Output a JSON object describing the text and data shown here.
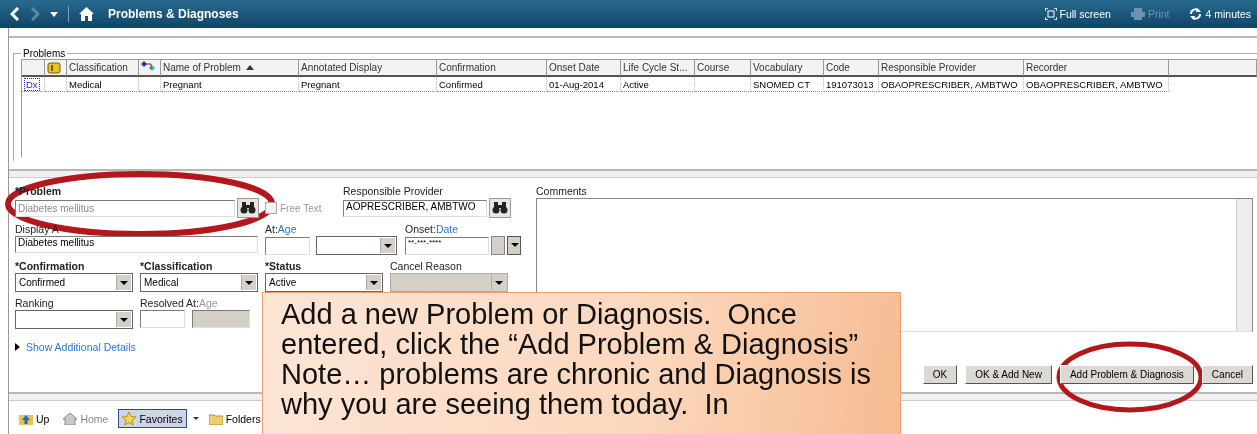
{
  "header": {
    "title": "Problems & Diagnoses",
    "actions": [
      {
        "label": "Full screen",
        "kind": "fullscreen",
        "disabled": false
      },
      {
        "label": "Print",
        "kind": "print",
        "disabled": true
      },
      {
        "label": "4 minutes",
        "kind": "refresh",
        "disabled": false
      }
    ]
  },
  "problems": {
    "legend": "Problems",
    "columns": [
      {
        "kind": "marker"
      },
      {
        "kind": "icon"
      },
      {
        "kind": "text",
        "label": "Classification",
        "sorted": false
      },
      {
        "kind": "icon"
      },
      {
        "kind": "text",
        "label": "Name of Problem",
        "sorted": true
      },
      {
        "kind": "text",
        "label": "Annotated Display",
        "sorted": false
      },
      {
        "kind": "text",
        "label": "Confirmation",
        "sorted": false
      },
      {
        "kind": "text",
        "label": "Onset Date",
        "sorted": false
      },
      {
        "kind": "text",
        "label": "Life Cycle St...",
        "sorted": false
      },
      {
        "kind": "text",
        "label": "Course",
        "sorted": false
      },
      {
        "kind": "text",
        "label": "Vocabulary",
        "sorted": false
      },
      {
        "kind": "text",
        "label": "Code",
        "sorted": false
      },
      {
        "kind": "text",
        "label": "Responsible Provider",
        "sorted": false
      },
      {
        "kind": "text",
        "label": "Recorder",
        "sorted": false
      }
    ],
    "rows": [
      {
        "cells": [
          "Dx",
          "",
          "Medical",
          "",
          "Pregnant",
          "Pregnant",
          "Confirmed",
          "01-Aug-2014",
          "Active",
          "",
          "SNOMED CT",
          "191073013",
          "OBAOPRESCRIBER, AMBTWO",
          "OBAOPRESCRIBER, AMBTWO"
        ]
      }
    ]
  },
  "form": {
    "problem": {
      "label": "*Problem",
      "placeholder": "Diabetes mellitus"
    },
    "free_text": {
      "label": "Free Text",
      "checked": false,
      "disabled": true
    },
    "responsible_provider": {
      "label": "Responsible Provider",
      "value": "AOPRESCRIBER, AMBTWO"
    },
    "display_as": {
      "label": "Display A",
      "value": "Diabetes mellitus"
    },
    "at": {
      "label": "At:",
      "link": "Age"
    },
    "onset": {
      "label": "Onset:",
      "link": "Date",
      "value": "**-***-****"
    },
    "confirmation": {
      "label": "*Confirmation",
      "value": "Confirmed"
    },
    "classification": {
      "label": "*Classification",
      "value": "Medical"
    },
    "status": {
      "label": "*Status",
      "value": "Active"
    },
    "cancel_reason": {
      "label": "Cancel Reason",
      "disabled": true
    },
    "ranking": {
      "label": "Ranking"
    },
    "resolved": {
      "label": "Resolved At:",
      "link": "Age",
      "disabled": true
    },
    "show_details": "Show Additional Details",
    "comments": {
      "label": "Comments"
    }
  },
  "buttons": [
    "OK",
    "OK & Add New",
    "Add Problem & Diagnosis",
    "Cancel"
  ],
  "folder_bar": [
    {
      "label": "Up",
      "kind": "up",
      "selected": false,
      "disabled": false
    },
    {
      "label": "Home",
      "kind": "home",
      "selected": false,
      "disabled": true
    },
    {
      "label": "Favorites",
      "kind": "star",
      "selected": true,
      "disabled": false
    },
    {
      "kind": "dropdown"
    },
    {
      "label": "Folders",
      "kind": "folder",
      "selected": false,
      "disabled": false
    }
  ],
  "callout": "Add a new Problem or Diagnosis.  Once entered, click the “Add Problem & Diagnosis” Note… problems are chronic and Diagnosis is why you are seeing them today.  In"
}
